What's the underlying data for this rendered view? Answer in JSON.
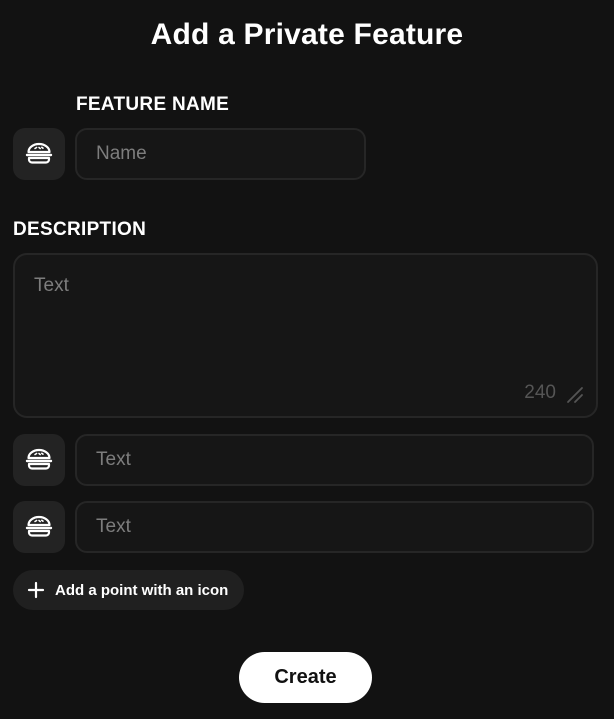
{
  "dialog": {
    "title": "Add a Private Feature"
  },
  "feature_name": {
    "label": "FEATURE NAME",
    "icon": "burger-icon",
    "placeholder": "Name",
    "value": ""
  },
  "description": {
    "label": "DESCRIPTION",
    "placeholder": "Text",
    "value": "",
    "char_limit": "240"
  },
  "points": [
    {
      "icon": "burger-icon",
      "placeholder": "Text",
      "value": ""
    },
    {
      "icon": "burger-icon",
      "placeholder": "Text",
      "value": ""
    }
  ],
  "add_point": {
    "icon": "plus-icon",
    "label": "Add a point with an icon"
  },
  "actions": {
    "create_label": "Create"
  },
  "colors": {
    "background": "#121212",
    "field_border": "#262626",
    "icon_tile": "#232323",
    "primary_button": "#ffffff"
  }
}
